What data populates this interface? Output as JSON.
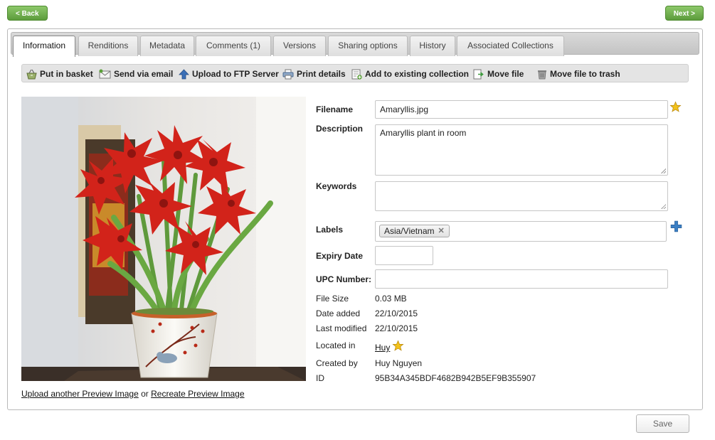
{
  "nav": {
    "back_label": "< Back",
    "next_label": "Next >"
  },
  "tabs": [
    {
      "label": "Information"
    },
    {
      "label": "Renditions"
    },
    {
      "label": "Metadata"
    },
    {
      "label": "Comments (1)"
    },
    {
      "label": "Versions"
    },
    {
      "label": "Sharing options"
    },
    {
      "label": "History"
    },
    {
      "label": "Associated Collections"
    }
  ],
  "toolbar": {
    "put_in_basket": "Put in basket",
    "send_via_email": "Send via email",
    "upload_ftp": "Upload to FTP Server",
    "print_details": "Print details",
    "add_to_collection": "Add to existing collection",
    "move_file": "Move file",
    "move_to_trash": "Move file to trash"
  },
  "preview": {
    "upload_link": "Upload another Preview Image",
    "or_text": "or",
    "recreate_link": "Recreate Preview Image"
  },
  "fields": {
    "filename_label": "Filename",
    "filename_value": "Amaryllis.jpg",
    "description_label": "Description",
    "description_value": "Amaryllis plant in room",
    "keywords_label": "Keywords",
    "keywords_value": "",
    "labels_label": "Labels",
    "label_chip": "Asia/Vietnam",
    "expiry_label": "Expiry Date",
    "expiry_value": "",
    "upc_label": "UPC Number:",
    "upc_value": ""
  },
  "info": {
    "file_size_label": "File Size",
    "file_size_value": "0.03 MB",
    "date_added_label": "Date added",
    "date_added_value": "22/10/2015",
    "last_modified_label": "Last modified",
    "last_modified_value": "22/10/2015",
    "located_in_label": "Located in",
    "located_in_value": "Huy",
    "created_by_label": "Created by",
    "created_by_value": "Huy Nguyen",
    "id_label": "ID",
    "id_value": "95B34A345BDF4682B942B5EF9B355907"
  },
  "save_label": "Save",
  "colors": {
    "nav_green": "#6aaa48",
    "star": "#f2c21b",
    "plus": "#3b7fc4"
  }
}
